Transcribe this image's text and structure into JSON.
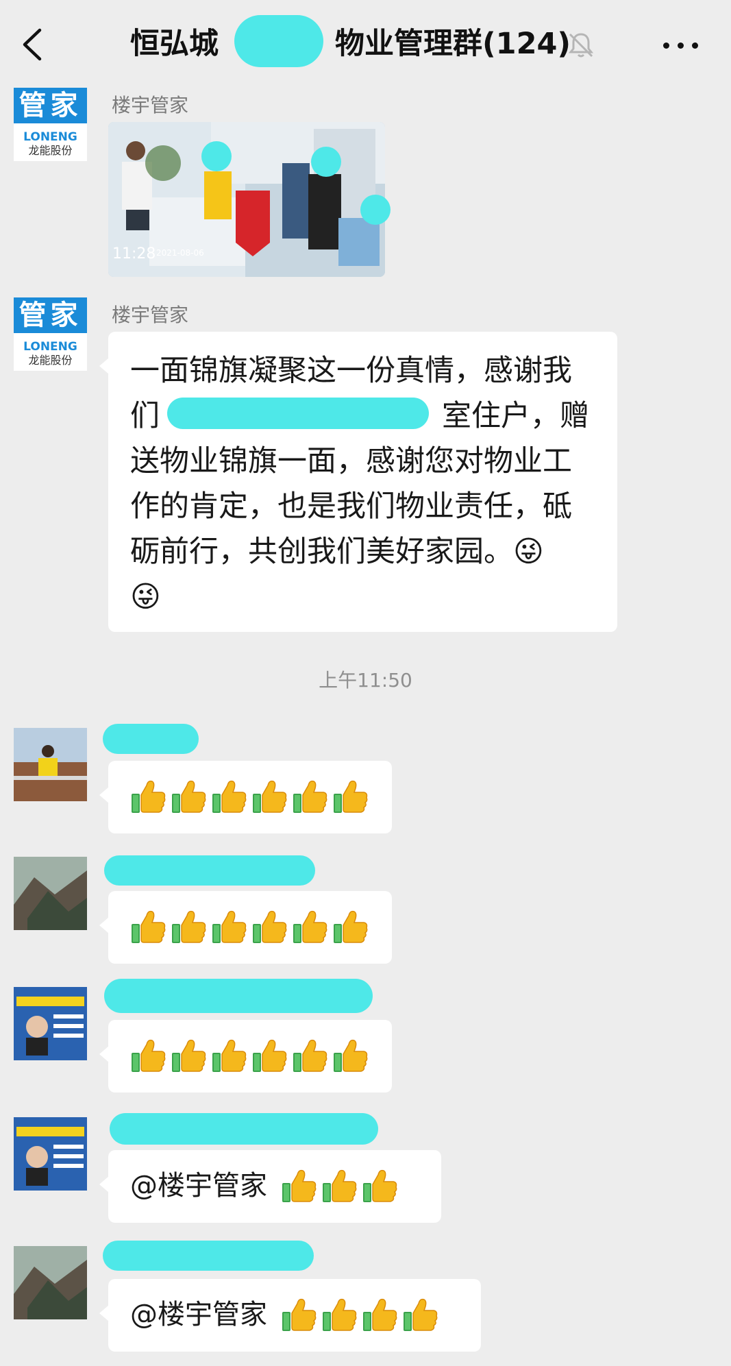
{
  "header": {
    "title_left": "恒弘城",
    "title_right": "物业管理群(124)"
  },
  "messages": [
    {
      "sender": "楼宇管家",
      "type": "image",
      "time": "11:28",
      "date": "2021-08-06"
    },
    {
      "sender": "楼宇管家",
      "type": "text",
      "line1": "一面锦旗凝聚这一份真情，感谢我",
      "line2": "们",
      "line2_suffix": "室住户，赠",
      "line3": "送物业锦旗一面，感谢您对物业工",
      "line4": "作的肯定，也是我们物业责任，砥",
      "line5": "砺前行，共创我们美好家园。😜",
      "line6": "😜"
    }
  ],
  "timestamp": "上午11:50",
  "logo": {
    "top": "管家",
    "brand": "LONENG",
    "company": "龙能股份"
  },
  "replies": [
    {
      "thumbs": 6
    },
    {
      "thumbs": 6
    },
    {
      "thumbs": 6
    },
    {
      "mention": "@楼宇管家",
      "thumbs": 3
    },
    {
      "mention": "@楼宇管家",
      "thumbs": 4
    }
  ],
  "colors": {
    "redaction": "#4ee8e8",
    "brand_blue": "#1a8bd8",
    "background": "#ededed"
  },
  "icons": [
    "back-icon",
    "bell-muted-icon",
    "more-icon",
    "thumbs-up-icon"
  ]
}
